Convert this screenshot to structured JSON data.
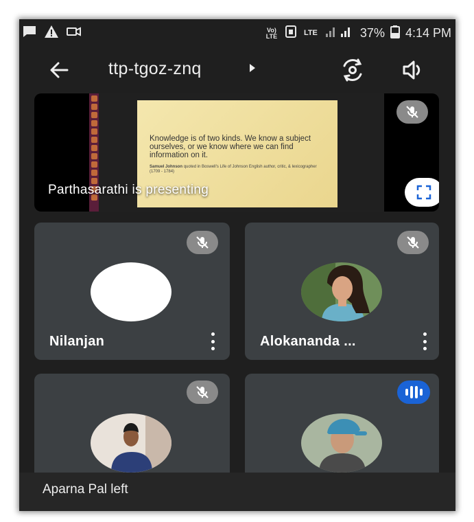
{
  "status_bar": {
    "volte": "Vo) LTE",
    "lte": "LTE",
    "battery": "37%",
    "time": "4:14 PM"
  },
  "toolbar": {
    "meeting_code": "ttp-tgoz-znq"
  },
  "presentation": {
    "label": "Parthasarathi is presenting",
    "slide_quote": "Knowledge is of two kinds. We know a subject ourselves, or we know where we can find information on it.",
    "slide_author": "Samuel Johnson",
    "slide_attribution": "quoted in Boswell's Life of Johnson English author, critic, & lexicographer (1709 - 1784)"
  },
  "participants": [
    {
      "name": "Nilanjan",
      "muted": true
    },
    {
      "name": "Alokananda ...",
      "muted": true
    },
    {
      "name": "",
      "muted": true
    },
    {
      "name": "",
      "muted": false,
      "speaking": true
    }
  ],
  "toast": {
    "message": "Aparna Pal left"
  },
  "colors": {
    "background": "#1f1f1f",
    "tile": "#3c4043",
    "speaking_badge": "#1a63d6",
    "mute_badge": "#8a8a8a"
  },
  "icons": [
    "chat-icon",
    "warning-icon",
    "video-call-icon",
    "volte-icon",
    "sim-icon",
    "signal-icon",
    "battery-icon",
    "back-arrow-icon",
    "caret-right-icon",
    "switch-camera-icon",
    "speaker-icon",
    "mic-off-icon",
    "fullscreen-icon",
    "more-vert-icon",
    "speaking-icon"
  ]
}
